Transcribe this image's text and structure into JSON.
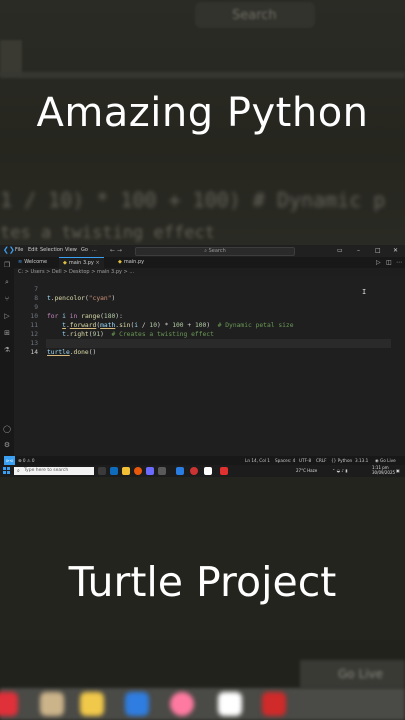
{
  "overlay": {
    "title_top": "Amazing Python",
    "title_bottom": "Turtle Project"
  },
  "background_blur": {
    "search_text": "Search",
    "code_line": "1 / 10) * 100 + 100)  # Dynamic p",
    "comment_line": "tes a twisting effect",
    "bottom_right_text": "Go Live"
  },
  "vscode": {
    "menu": [
      "File",
      "Edit",
      "Selection",
      "View",
      "Go",
      "..."
    ],
    "search_placeholder": "Search",
    "tabs": [
      {
        "label": "Welcome",
        "active": false
      },
      {
        "label": "main 3.py",
        "active": true
      },
      {
        "label": "main.py",
        "active": false
      }
    ],
    "breadcrumb": "C: > Users > Dell > Desktop > main 3.py > ...",
    "lines": [
      {
        "num": "7",
        "text": "t.pencolor(\"cyan\")"
      },
      {
        "num": "8",
        "text": ""
      },
      {
        "num": "9",
        "text": "for i in range(180):"
      },
      {
        "num": "10",
        "text": "    t.forward(math.sin(i / 10) * 100 + 100)  # Dynamic petal size"
      },
      {
        "num": "11",
        "text": "    t.right(91)  # Creates a twisting effect"
      },
      {
        "num": "12",
        "text": ""
      },
      {
        "num": "13",
        "text": "turtle.done()"
      },
      {
        "num": "14",
        "text": ""
      }
    ],
    "status": {
      "left": "⊗ 0 ⚠ 0",
      "ln_col": "Ln 14, Col 1",
      "spaces": "Spaces: 4",
      "encoding": "UTF-8",
      "eol": "CRLF",
      "lang": "{} Python",
      "version": "3.13.1",
      "golive": "◉ Go Live"
    }
  },
  "taskbar": {
    "search_placeholder": "Type here to search",
    "weather": "27°C Haze",
    "time": "1:11 pm",
    "date": "30/09/2025"
  },
  "colors": {
    "accent": "#3aa0f3",
    "keyword": "#c586c0",
    "function": "#dcdcaa",
    "string": "#ce9178",
    "comment": "#6a9955",
    "number": "#b5cea8"
  }
}
